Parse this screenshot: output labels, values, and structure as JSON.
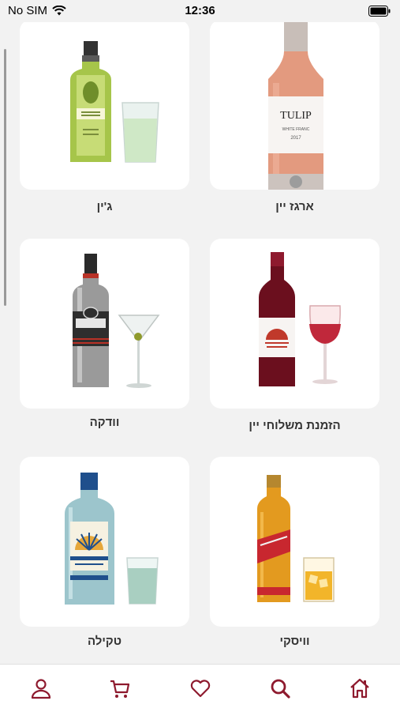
{
  "status_bar": {
    "carrier": "No SIM",
    "time": "12:36"
  },
  "categories": [
    {
      "label": "ארגז יין",
      "icon": "rose-wine-bottle-icon",
      "bottle_label": "TULIP",
      "bottle_sub": "WHITE FRANC",
      "bottle_year": "2017"
    },
    {
      "label": "ג'ין",
      "icon": "gin-bottle-icon"
    },
    {
      "label": "הזמנת משלוחי יין",
      "icon": "red-wine-bottle-icon"
    },
    {
      "label": "וודקה",
      "icon": "vodka-bottle-icon"
    },
    {
      "label": "וויסקי",
      "icon": "whisky-bottle-icon"
    },
    {
      "label": "טקילה",
      "icon": "tequila-bottle-icon"
    }
  ],
  "tabbar": {
    "accent_color": "#8e1a2e",
    "items": [
      "home-icon",
      "search-icon",
      "heart-icon",
      "cart-icon",
      "user-icon"
    ]
  }
}
